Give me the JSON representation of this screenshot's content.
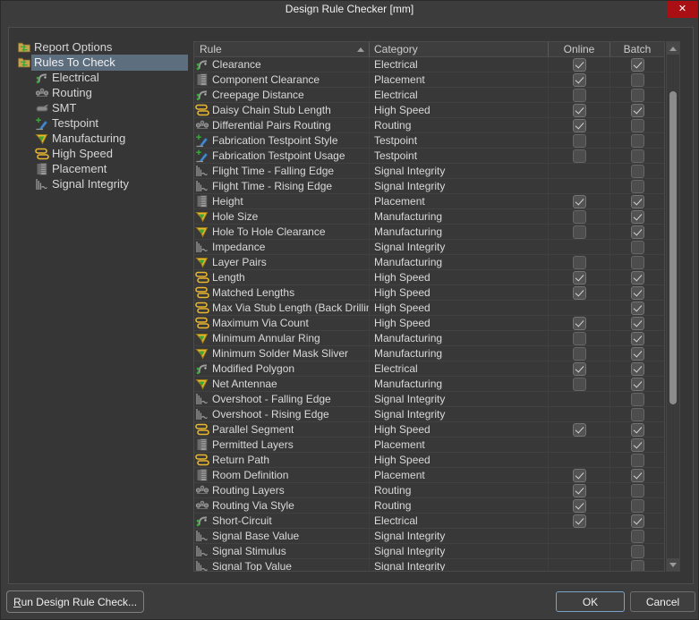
{
  "window": {
    "title": "Design Rule Checker [mm]",
    "close_icon": "✕"
  },
  "sidebar": {
    "items": [
      {
        "label": "Report Options",
        "icon": "folder-exchange-icon",
        "level": 0,
        "selected": false
      },
      {
        "label": "Rules To Check",
        "icon": "folder-exchange-icon",
        "level": 0,
        "selected": true
      },
      {
        "label": "Electrical",
        "icon": "electrical-icon",
        "level": 1,
        "selected": false
      },
      {
        "label": "Routing",
        "icon": "routing-icon",
        "level": 1,
        "selected": false
      },
      {
        "label": "SMT",
        "icon": "smt-icon",
        "level": 1,
        "selected": false
      },
      {
        "label": "Testpoint",
        "icon": "testpoint-icon",
        "level": 1,
        "selected": false
      },
      {
        "label": "Manufacturing",
        "icon": "manufacturing-icon",
        "level": 1,
        "selected": false
      },
      {
        "label": "High Speed",
        "icon": "high-speed-icon",
        "level": 1,
        "selected": false
      },
      {
        "label": "Placement",
        "icon": "placement-icon",
        "level": 1,
        "selected": false
      },
      {
        "label": "Signal Integrity",
        "icon": "signal-integrity-icon",
        "level": 1,
        "selected": false
      }
    ]
  },
  "table": {
    "columns": {
      "rule": "Rule",
      "category": "Category",
      "online": "Online",
      "batch": "Batch"
    },
    "sort": {
      "column": "Rule",
      "direction": "ascending"
    },
    "rules": [
      {
        "name": "Clearance",
        "category": "Electrical",
        "icon": "electrical-icon",
        "online": "checked",
        "batch": "checked"
      },
      {
        "name": "Component Clearance",
        "category": "Placement",
        "icon": "placement-icon",
        "online": "checked",
        "batch": "unchecked"
      },
      {
        "name": "Creepage Distance",
        "category": "Electrical",
        "icon": "electrical-icon",
        "online": "unchecked",
        "batch": "unchecked"
      },
      {
        "name": "Daisy Chain Stub Length",
        "category": "High Speed",
        "icon": "high-speed-icon",
        "online": "checked",
        "batch": "checked"
      },
      {
        "name": "Differential Pairs Routing",
        "category": "Routing",
        "icon": "routing-icon",
        "online": "checked",
        "batch": "unchecked"
      },
      {
        "name": "Fabrication Testpoint Style",
        "category": "Testpoint",
        "icon": "testpoint-icon",
        "online": "unchecked",
        "batch": "unchecked"
      },
      {
        "name": "Fabrication Testpoint Usage",
        "category": "Testpoint",
        "icon": "testpoint-icon",
        "online": "unchecked",
        "batch": "unchecked"
      },
      {
        "name": "Flight Time - Falling Edge",
        "category": "Signal Integrity",
        "icon": "signal-integrity-icon",
        "online": "none",
        "batch": "unchecked"
      },
      {
        "name": "Flight Time - Rising Edge",
        "category": "Signal Integrity",
        "icon": "signal-integrity-icon",
        "online": "none",
        "batch": "unchecked"
      },
      {
        "name": "Height",
        "category": "Placement",
        "icon": "placement-icon",
        "online": "checked",
        "batch": "checked"
      },
      {
        "name": "Hole Size",
        "category": "Manufacturing",
        "icon": "manufacturing-icon",
        "online": "unchecked",
        "batch": "checked"
      },
      {
        "name": "Hole To Hole Clearance",
        "category": "Manufacturing",
        "icon": "manufacturing-icon",
        "online": "unchecked",
        "batch": "checked"
      },
      {
        "name": "Impedance",
        "category": "Signal Integrity",
        "icon": "signal-integrity-icon",
        "online": "none",
        "batch": "unchecked"
      },
      {
        "name": "Layer Pairs",
        "category": "Manufacturing",
        "icon": "manufacturing-icon",
        "online": "unchecked",
        "batch": "unchecked"
      },
      {
        "name": "Length",
        "category": "High Speed",
        "icon": "high-speed-icon",
        "online": "checked",
        "batch": "checked"
      },
      {
        "name": "Matched Lengths",
        "category": "High Speed",
        "icon": "high-speed-icon",
        "online": "checked",
        "batch": "checked"
      },
      {
        "name": "Max Via Stub Length (Back Drilling)",
        "category": "High Speed",
        "icon": "high-speed-icon",
        "online": "none",
        "batch": "checked"
      },
      {
        "name": "Maximum Via Count",
        "category": "High Speed",
        "icon": "high-speed-icon",
        "online": "checked",
        "batch": "checked"
      },
      {
        "name": "Minimum Annular Ring",
        "category": "Manufacturing",
        "icon": "manufacturing-icon",
        "online": "unchecked",
        "batch": "checked"
      },
      {
        "name": "Minimum Solder Mask Sliver",
        "category": "Manufacturing",
        "icon": "manufacturing-icon",
        "online": "unchecked",
        "batch": "checked"
      },
      {
        "name": "Modified Polygon",
        "category": "Electrical",
        "icon": "electrical-icon",
        "online": "checked",
        "batch": "checked"
      },
      {
        "name": "Net Antennae",
        "category": "Manufacturing",
        "icon": "manufacturing-icon",
        "online": "unchecked",
        "batch": "checked"
      },
      {
        "name": "Overshoot - Falling Edge",
        "category": "Signal Integrity",
        "icon": "signal-integrity-icon",
        "online": "none",
        "batch": "unchecked"
      },
      {
        "name": "Overshoot - Rising Edge",
        "category": "Signal Integrity",
        "icon": "signal-integrity-icon",
        "online": "none",
        "batch": "unchecked"
      },
      {
        "name": "Parallel Segment",
        "category": "High Speed",
        "icon": "high-speed-icon",
        "online": "checked",
        "batch": "checked"
      },
      {
        "name": "Permitted Layers",
        "category": "Placement",
        "icon": "placement-icon",
        "online": "none",
        "batch": "checked"
      },
      {
        "name": "Return Path",
        "category": "High Speed",
        "icon": "high-speed-icon",
        "online": "none",
        "batch": "unchecked"
      },
      {
        "name": "Room Definition",
        "category": "Placement",
        "icon": "placement-icon",
        "online": "checked",
        "batch": "checked"
      },
      {
        "name": "Routing Layers",
        "category": "Routing",
        "icon": "routing-icon",
        "online": "checked",
        "batch": "unchecked"
      },
      {
        "name": "Routing Via Style",
        "category": "Routing",
        "icon": "routing-icon",
        "online": "checked",
        "batch": "unchecked"
      },
      {
        "name": "Short-Circuit",
        "category": "Electrical",
        "icon": "electrical-icon",
        "online": "checked",
        "batch": "checked"
      },
      {
        "name": "Signal Base Value",
        "category": "Signal Integrity",
        "icon": "signal-integrity-icon",
        "online": "none",
        "batch": "unchecked"
      },
      {
        "name": "Signal Stimulus",
        "category": "Signal Integrity",
        "icon": "signal-integrity-icon",
        "online": "none",
        "batch": "unchecked"
      },
      {
        "name": "Signal Top Value",
        "category": "Signal Integrity",
        "icon": "signal-integrity-icon",
        "online": "none",
        "batch": "unchecked"
      }
    ]
  },
  "footer": {
    "run_button": "Run Design Rule Check...",
    "run_mnemonic": "R",
    "ok_button": "OK",
    "cancel_button": "Cancel"
  },
  "colors": {
    "selection": "#5d6e7f",
    "close_button": "#a90f13",
    "ok_border": "#7ba2c9",
    "icon_yellow": "#eab62e",
    "icon_green": "#35a835",
    "icon_blue": "#4a8fd4"
  }
}
